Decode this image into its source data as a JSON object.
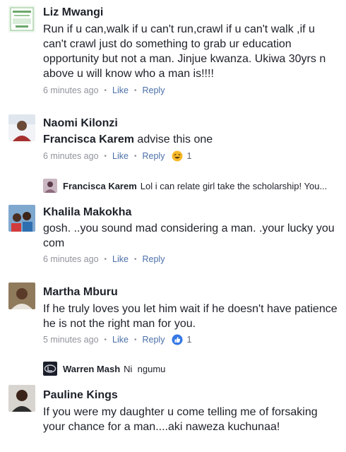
{
  "comments": [
    {
      "author": "Liz Mwangi",
      "text": "Run if u can,walk if u can't run,crawl if u can't walk ,if u can't crawl just do something to grab ur education opportunity but not a man. Jinjue kwanza. Ukiwa 30yrs n above u will know who a man is!!!!",
      "time": "6 minutes ago",
      "like": "Like",
      "reply": "Reply"
    },
    {
      "author": "Naomi Kilonzi",
      "mention": "Francisca Karem",
      "text": " advise this one",
      "time": "6 minutes ago",
      "like": "Like",
      "reply": "Reply",
      "reaction_count": "1",
      "reaction_icon": "haha-emoji-icon"
    },
    {
      "author": "Khalila Makokha",
      "text": "gosh. ..you sound mad considering a man. .your lucky you com",
      "time": "6 minutes ago",
      "like": "Like",
      "reply": "Reply"
    },
    {
      "author": "Martha Mburu",
      "text": "If he truly loves you let him wait if he doesn't have patience he is not the right man for you.",
      "time": "5 minutes ago",
      "like": "Like",
      "reply": "Reply",
      "reaction_count": "1",
      "reaction_icon": "like-thumb-icon"
    },
    {
      "author": "Pauline Kings",
      "text": "If you were my daughter u come telling me of forsaking your chance for a man....aki naweza kuchunaa!"
    }
  ],
  "replies": [
    {
      "author": "Francisca Karem",
      "text": "Lol i can relate girl take the scholarship! You..."
    },
    {
      "author": "Warren Mash",
      "text": "Ni  ngumu"
    }
  ],
  "colors": {
    "link": "#4b6fa8",
    "meta": "#90949c",
    "text": "#1d2129",
    "like_blue": "#3578e5",
    "haha_yellow": "#f7b928"
  }
}
